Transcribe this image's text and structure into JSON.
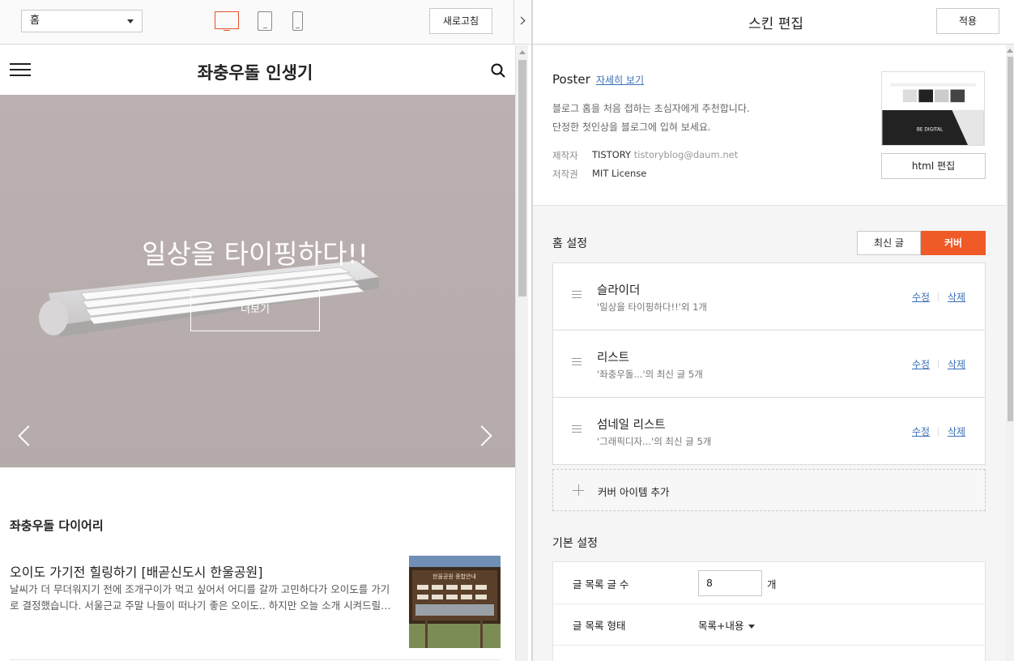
{
  "preview_toolbar": {
    "page_select": "홈",
    "refresh_label": "새로고침"
  },
  "blog": {
    "title": "좌충우돌 인생기",
    "hero_title": "일상을 타이핑하다!!",
    "hero_button": "더보기",
    "section_title": "좌충우돌 다이어리",
    "post": {
      "title": "오이도 가기전 힐링하기 [배곧신도시 한울공원]",
      "excerpt": "날씨가 더 무더워지기 전에 조개구이가 먹고 싶어서 어디를 갈까 고민하다가 오이도를 가기로 결정했습니다. 서울근교 주말 나들이 떠나기 좋은 오이도.. 하지만 오늘 소개 시켜드릴…",
      "thumb_sign": "한울공원 종합안내"
    }
  },
  "editor": {
    "title": "스킨 편집",
    "apply_label": "적용",
    "skin": {
      "name": "Poster",
      "detail_link": "자세히 보기",
      "desc1": "블로그 홈을 처음 접하는 초심자에게 추천합니다.",
      "desc2": "단정한 첫인상을 블로그에 입혀 보세요.",
      "maker_label": "제작자",
      "maker_value": "TISTORY",
      "maker_email": "tistoryblog@daum.net",
      "license_label": "저작권",
      "license_value": "MIT License",
      "thumb_text": "BE DIGITAL",
      "html_edit_label": "html 편집"
    },
    "home_settings": {
      "label": "홈 설정",
      "tab_recent": "최신 글",
      "tab_cover": "커버",
      "items": [
        {
          "title": "슬라이더",
          "sub": "'일상을 타이핑하다!!'외 1개",
          "edit": "수정",
          "delete": "삭제"
        },
        {
          "title": "리스트",
          "sub": "'좌충우돌...'의 최신 글 5개",
          "edit": "수정",
          "delete": "삭제"
        },
        {
          "title": "섬네일 리스트",
          "sub": "'그래픽디자...'의 최신 글 5개",
          "edit": "수정",
          "delete": "삭제"
        }
      ],
      "add_label": "커버 아이템 추가"
    },
    "basic_settings": {
      "label": "기본 설정",
      "post_count_label": "글 목록 글 수",
      "post_count_value": "8",
      "post_count_unit": "개",
      "post_format_label": "글 목록 형태",
      "post_format_value": "목록+내용"
    }
  },
  "colors": {
    "accent": "#ef5a27",
    "link": "#3b6fb6",
    "hero_bg": "#b8adad"
  }
}
